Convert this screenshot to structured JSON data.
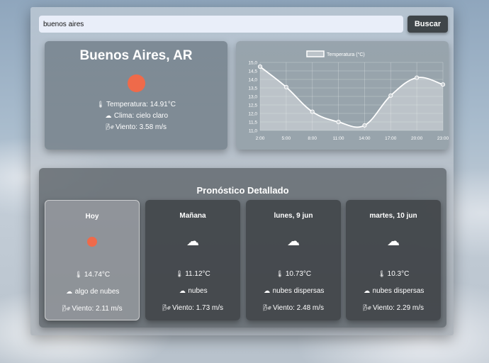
{
  "search": {
    "value": "buenos aires",
    "button_label": "Buscar"
  },
  "current": {
    "city": "Buenos Aires, AR",
    "icon": "sun-icon",
    "temperature": "Temperatura: 14.91°C",
    "climate": "Clima: cielo claro",
    "wind": "Viento: 3.58 m/s"
  },
  "chart_data": {
    "type": "line",
    "legend": "Temperatura (°C)",
    "x": [
      "2:00",
      "5:00",
      "8:00",
      "11:00",
      "14:00",
      "17:00",
      "20:00",
      "23:00"
    ],
    "y_ticks": [
      "15,0",
      "14,5",
      "14,0",
      "13,5",
      "13,0",
      "12,5",
      "12,0",
      "11,5",
      "11,0"
    ],
    "ylim": [
      11.0,
      15.0
    ],
    "series": [
      {
        "name": "Temperatura (°C)",
        "values": [
          14.75,
          13.55,
          12.1,
          11.5,
          11.3,
          13.05,
          14.1,
          13.7
        ]
      }
    ],
    "grid": true,
    "legend_position": "top-center",
    "colors": {
      "line": "#ffffff",
      "fill": "rgba(255,255,255,0.35)"
    }
  },
  "forecast": {
    "title": "Pronóstico Detallado",
    "days": [
      {
        "day": "Hoy",
        "icon": "sun-icon",
        "temp": "14.74°C",
        "desc": "algo de nubes",
        "wind": "Viento: 2.11 m/s"
      },
      {
        "day": "Mañana",
        "icon": "cloud-icon",
        "temp": "11.12°C",
        "desc": "nubes",
        "wind": "Viento: 1.73 m/s"
      },
      {
        "day": "lunes, 9 jun",
        "icon": "cloud-icon",
        "temp": "10.73°C",
        "desc": "nubes dispersas",
        "wind": "Viento: 2.48 m/s"
      },
      {
        "day": "martes, 10 jun",
        "icon": "cloud-icon",
        "temp": "10.3°C",
        "desc": "nubes dispersas",
        "wind": "Viento: 2.29 m/s"
      }
    ]
  },
  "icons": {
    "thermometer": "🌡",
    "cloud_small": "☁",
    "wind": "🌬",
    "cloud": "☁"
  },
  "colors": {
    "sun": "#ef6a4a",
    "button_bg": "#3f4549",
    "input_bg": "#e9eef9"
  }
}
